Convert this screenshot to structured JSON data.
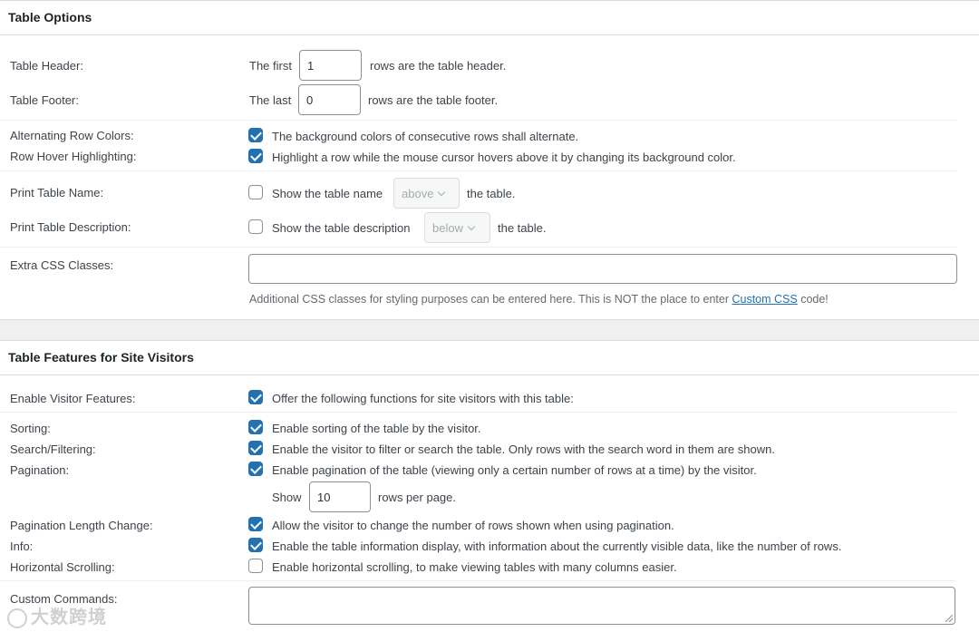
{
  "table_options": {
    "title": "Table Options",
    "table_header": {
      "label": "Table Header:",
      "prefix": "The first",
      "value": "1",
      "suffix": "rows are the table header."
    },
    "table_footer": {
      "label": "Table Footer:",
      "prefix": "The last",
      "value": "0",
      "suffix": "rows are the table footer."
    },
    "alternating_row_colors": {
      "label": "Alternating Row Colors:",
      "checked": true,
      "text": "The background colors of consecutive rows shall alternate."
    },
    "row_hover": {
      "label": "Row Hover Highlighting:",
      "checked": true,
      "text": "Highlight a row while the mouse cursor hovers above it by changing its background color."
    },
    "print_name": {
      "label": "Print Table Name:",
      "checked": false,
      "prefix": "Show the table name",
      "select": "above",
      "suffix": "the table."
    },
    "print_description": {
      "label": "Print Table Description:",
      "checked": false,
      "prefix": "Show the table description",
      "select": "below",
      "suffix": "the table."
    },
    "extra_css": {
      "label": "Extra CSS Classes:",
      "value": "",
      "help_before": "Additional CSS classes for styling purposes can be entered here. This is NOT the place to enter ",
      "help_link": "Custom CSS",
      "help_after": " code!"
    }
  },
  "visitor_features": {
    "title": "Table Features for Site Visitors",
    "enable": {
      "label": "Enable Visitor Features:",
      "checked": true,
      "text": "Offer the following functions for site visitors with this table:"
    },
    "sorting": {
      "label": "Sorting:",
      "checked": true,
      "text": "Enable sorting of the table by the visitor."
    },
    "search": {
      "label": "Search/Filtering:",
      "checked": true,
      "text": "Enable the visitor to filter or search the table. Only rows with the search word in them are shown."
    },
    "pagination": {
      "label": "Pagination:",
      "checked": true,
      "text": "Enable pagination of the table (viewing only a certain number of rows at a time) by the visitor.",
      "show_label": "Show",
      "rows_value": "10",
      "rows_suffix": "rows per page."
    },
    "length_change": {
      "label": "Pagination Length Change:",
      "checked": true,
      "text": "Allow the visitor to change the number of rows shown when using pagination."
    },
    "info": {
      "label": "Info:",
      "checked": true,
      "text": "Enable the table information display, with information about the currently visible data, like the number of rows."
    },
    "horizontal_scrolling": {
      "label": "Horizontal Scrolling:",
      "checked": false,
      "text": "Enable horizontal scrolling, to make viewing tables with many columns easier."
    },
    "custom_commands": {
      "label": "Custom Commands:",
      "value": ""
    }
  },
  "watermark": "大数跨境",
  "colors": {
    "accent": "#2271b1",
    "border": "#8c8f94",
    "text": "#3c434a"
  }
}
